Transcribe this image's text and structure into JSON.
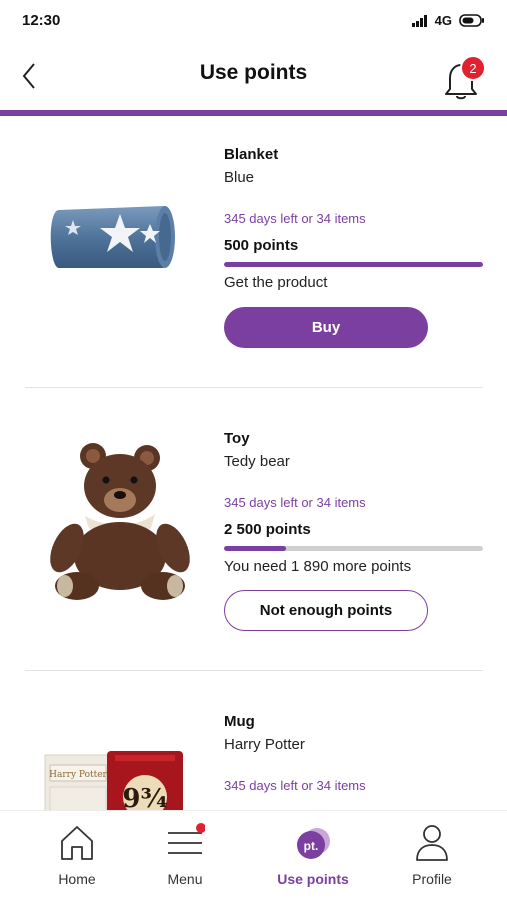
{
  "status_bar": {
    "time": "12:30",
    "network": "4G"
  },
  "header": {
    "title": "Use points",
    "notification_count": "2"
  },
  "colors": {
    "accent": "#7b3fa0",
    "badge": "#e0212f",
    "track": "#cfcfcf"
  },
  "products": [
    {
      "name": "Blanket",
      "variant": "Blue",
      "availability": "345 days left or 34 items",
      "points": "500 points",
      "progress_fraction": 1.0,
      "status": "Get the product",
      "button_label": "Buy",
      "button_enabled": true
    },
    {
      "name": "Toy",
      "variant": "Tedy bear",
      "availability": "345 days left or 34 items",
      "points": "2 500 points",
      "progress_fraction": 0.24,
      "status": "You need 1 890 more points",
      "button_label": "Not enough points",
      "button_enabled": false
    },
    {
      "name": "Mug",
      "variant": "Harry Potter",
      "availability": "345 days left or 34 items",
      "mug_number": "9¾",
      "mug_brand": "Harry Potter"
    }
  ],
  "bottom_nav": {
    "items": [
      {
        "label": "Home",
        "icon": "home-icon",
        "active": false
      },
      {
        "label": "Menu",
        "icon": "menu-icon",
        "active": false
      },
      {
        "label": "Use points",
        "icon": "points-icon",
        "active": true,
        "icon_text": "pt."
      },
      {
        "label": "Profile",
        "icon": "profile-icon",
        "active": false
      }
    ]
  }
}
